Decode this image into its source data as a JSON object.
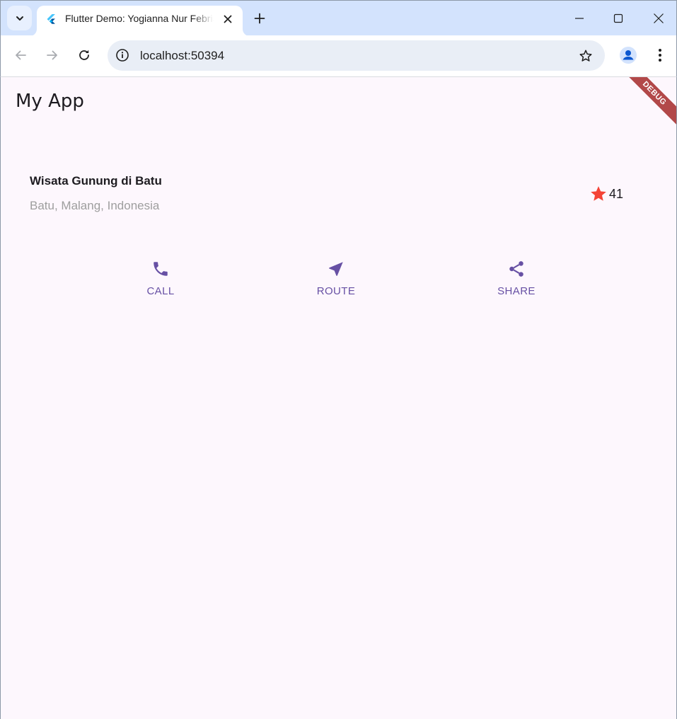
{
  "browser": {
    "tab_title": "Flutter Demo: Yogianna Nur Febrianto",
    "url": "localhost:50394"
  },
  "app": {
    "title": "My App",
    "debug_banner": "DEBUG"
  },
  "place": {
    "name": "Wisata Gunung di Batu",
    "location": "Batu, Malang, Indonesia",
    "rating_count": "41"
  },
  "actions": [
    {
      "icon": "phone-icon",
      "label": "CALL"
    },
    {
      "icon": "near-me-icon",
      "label": "ROUTE"
    },
    {
      "icon": "share-icon",
      "label": "SHARE"
    }
  ],
  "colors": {
    "accent": "#6750a4",
    "star": "#f44336",
    "background": "#fdf7fd"
  }
}
